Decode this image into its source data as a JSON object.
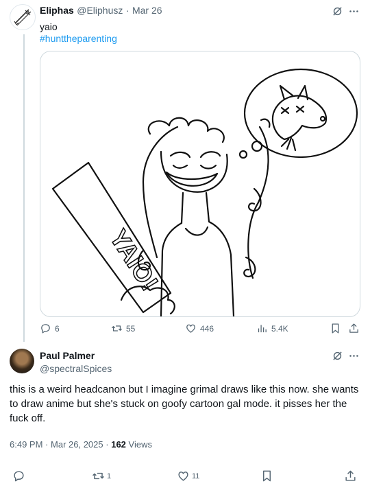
{
  "tweet": {
    "author_name": "Eliphas",
    "author_handle": "@Eliphusz",
    "date": "Mar 26",
    "separator": "·",
    "text": "yaio",
    "hashtag": "#hunttheparenting",
    "drawing": {
      "sign_text": "YAIO!"
    },
    "replies": "6",
    "reposts": "55",
    "likes": "446",
    "views": "5.4K"
  },
  "reply": {
    "author_name": "Paul Palmer",
    "author_handle": "@spectralSpices",
    "text": "this is a weird headcanon but I imagine grimal draws like this now. she wants to draw anime but she's stuck on goofy cartoon gal mode. it pisses her the fuck off.",
    "time": "6:49 PM",
    "date": "Mar 26, 2025",
    "separator": "·",
    "views_count": "162",
    "views_label": "Views",
    "reposts": "1",
    "likes": "11"
  },
  "icons": [
    "grok-icon",
    "more-icon",
    "reply-icon",
    "repost-icon",
    "like-icon",
    "views-icon",
    "bookmark-icon",
    "share-icon"
  ],
  "colors": {
    "link": "#1d9bf0",
    "muted": "#536471",
    "text": "#0f1419",
    "border": "#cfd9de"
  }
}
